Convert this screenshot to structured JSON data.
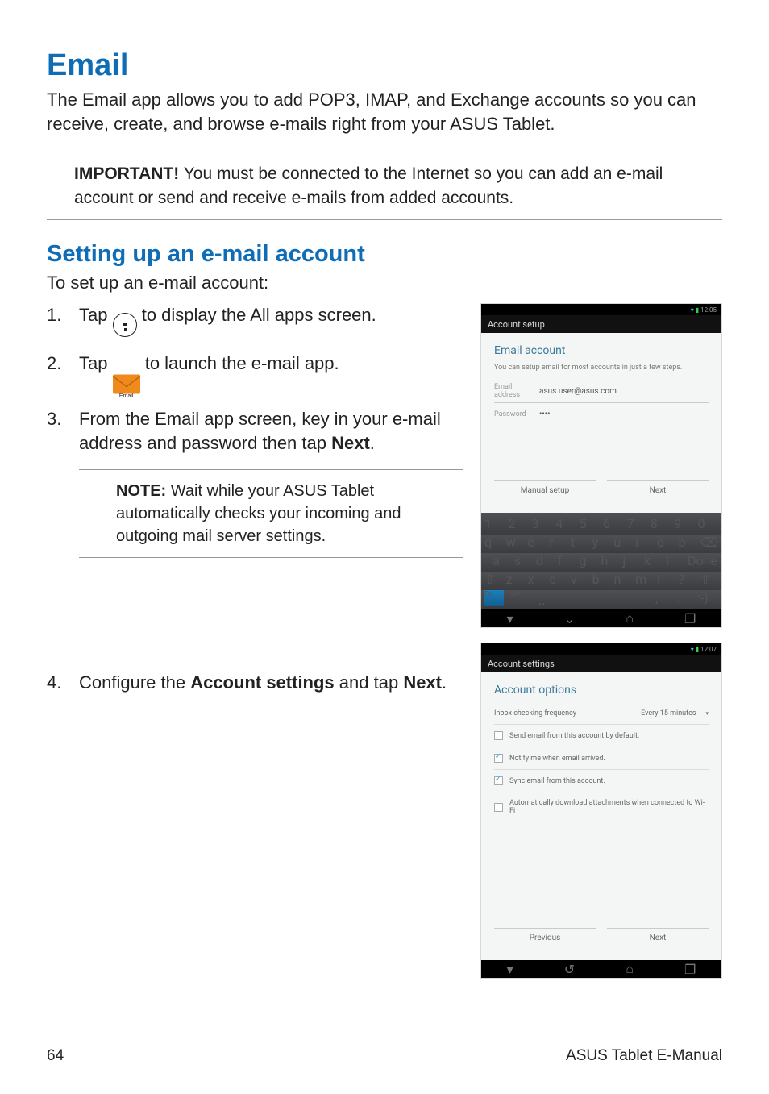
{
  "headings": {
    "h1": "Email",
    "h2": "Setting up an e-mail account"
  },
  "intro": "The Email app allows you to add POP3, IMAP, and Exchange accounts so you can receive, create, and browse e-mails right from your ASUS Tablet.",
  "important": {
    "label": "IMPORTANT!",
    "text": " You must be connected to the Internet so you can add an e-mail account or send and receive e-mails from added accounts."
  },
  "lead": "To set up an e-mail account:",
  "steps": {
    "s1a": "Tap ",
    "s1b": " to display the All apps screen.",
    "s2a": "Tap ",
    "s2b": " to launch the e-mail app.",
    "email_icon_caption": "Email",
    "s3a": "From the Email app screen, key in your e-mail address and password then tap ",
    "s3b": "Next",
    "s3c": ".",
    "s4a": "Configure the ",
    "s4b": "Account settings",
    "s4c": " and tap ",
    "s4d": "Next",
    "s4e": "."
  },
  "note": {
    "label": "NOTE:",
    "text": " Wait while your ASUS Tablet automatically checks your incoming and outgoing mail server settings."
  },
  "shot1": {
    "status_time": "12:05",
    "appbar": "Account setup",
    "title": "Email account",
    "hint": "You can setup email for most accounts in just a few steps.",
    "email_label": "Email address",
    "email_value": "asus.user@asus.com",
    "pass_label": "Password",
    "pass_value": "••••",
    "btn_manual": "Manual setup",
    "btn_next": "Next",
    "keys_num": [
      "1",
      "2",
      "3",
      "4",
      "5",
      "6",
      "7",
      "8",
      "9",
      "0"
    ],
    "keys_r2": [
      "q",
      "w",
      "e",
      "r",
      "t",
      "y",
      "u",
      "i",
      "o",
      "p",
      "⌫"
    ],
    "keys_r3": [
      "a",
      "s",
      "d",
      "f",
      "g",
      "h",
      "j",
      "k",
      "l",
      "Done"
    ],
    "keys_r4": [
      "⇧",
      "z",
      "x",
      "c",
      "v",
      "b",
      "n",
      "m",
      "!",
      "?",
      "⇧"
    ],
    "keys_r5": {
      "en": "En",
      "sym": "1@#",
      "comma": ",",
      "period": ".",
      "smile": ":-)"
    }
  },
  "shot2": {
    "status_time": "12:07",
    "appbar": "Account settings",
    "title": "Account options",
    "freq_label": "Inbox checking frequency",
    "freq_value": "Every 15 minutes",
    "opts": [
      {
        "checked": false,
        "label": "Send email from this account by default."
      },
      {
        "checked": true,
        "label": "Notify me when email arrived."
      },
      {
        "checked": true,
        "label": "Sync email from this account."
      },
      {
        "checked": false,
        "label": "Automatically download attachments when connected to Wi-Fi"
      }
    ],
    "btn_prev": "Previous",
    "btn_next": "Next"
  },
  "footer": {
    "page": "64",
    "title": "ASUS Tablet E-Manual"
  }
}
